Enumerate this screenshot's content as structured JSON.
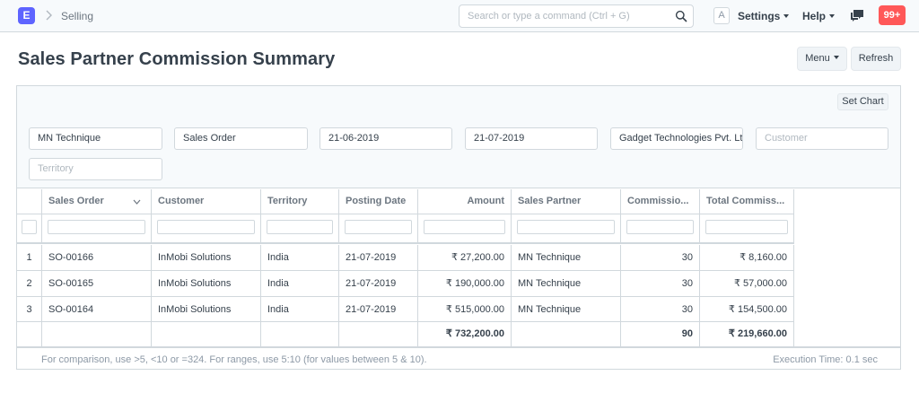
{
  "navbar": {
    "logo": "E",
    "breadcrumb": "Selling",
    "search_placeholder": "Search or type a command (Ctrl + G)",
    "avatar": "A",
    "settings_label": "Settings",
    "help_label": "Help",
    "notification_count": "99+"
  },
  "page": {
    "title": "Sales Partner Commission Summary",
    "menu_label": "Menu",
    "refresh_label": "Refresh",
    "set_chart_label": "Set Chart"
  },
  "filters": {
    "sales_partner": "MN Technique",
    "doctype": "Sales Order",
    "from_date": "21-06-2019",
    "to_date": "21-07-2019",
    "company": "Gadget Technologies Pvt. Ltd.",
    "customer_placeholder": "Customer",
    "territory_placeholder": "Territory"
  },
  "table": {
    "columns": [
      "Sales Order",
      "Customer",
      "Territory",
      "Posting Date",
      "Amount",
      "Sales Partner",
      "Commissio...",
      "Total Commiss..."
    ],
    "rows": [
      {
        "idx": "1",
        "order": "SO-00166",
        "customer": "InMobi Solutions",
        "territory": "India",
        "date": "21-07-2019",
        "amount": "₹ 27,200.00",
        "partner": "MN Technique",
        "rate": "30",
        "total": "₹ 8,160.00"
      },
      {
        "idx": "2",
        "order": "SO-00165",
        "customer": "InMobi Solutions",
        "territory": "India",
        "date": "21-07-2019",
        "amount": "₹ 190,000.00",
        "partner": "MN Technique",
        "rate": "30",
        "total": "₹ 57,000.00"
      },
      {
        "idx": "3",
        "order": "SO-00164",
        "customer": "InMobi Solutions",
        "territory": "India",
        "date": "21-07-2019",
        "amount": "₹ 515,000.00",
        "partner": "MN Technique",
        "rate": "30",
        "total": "₹ 154,500.00"
      }
    ],
    "totals": {
      "amount": "₹ 732,200.00",
      "rate": "90",
      "total": "₹ 219,660.00"
    }
  },
  "footer": {
    "hint": "For comparison, use >5, <10 or =324. For ranges, use 5:10 (for values between 5 & 10).",
    "execution_time": "Execution Time: 0.1 sec"
  }
}
